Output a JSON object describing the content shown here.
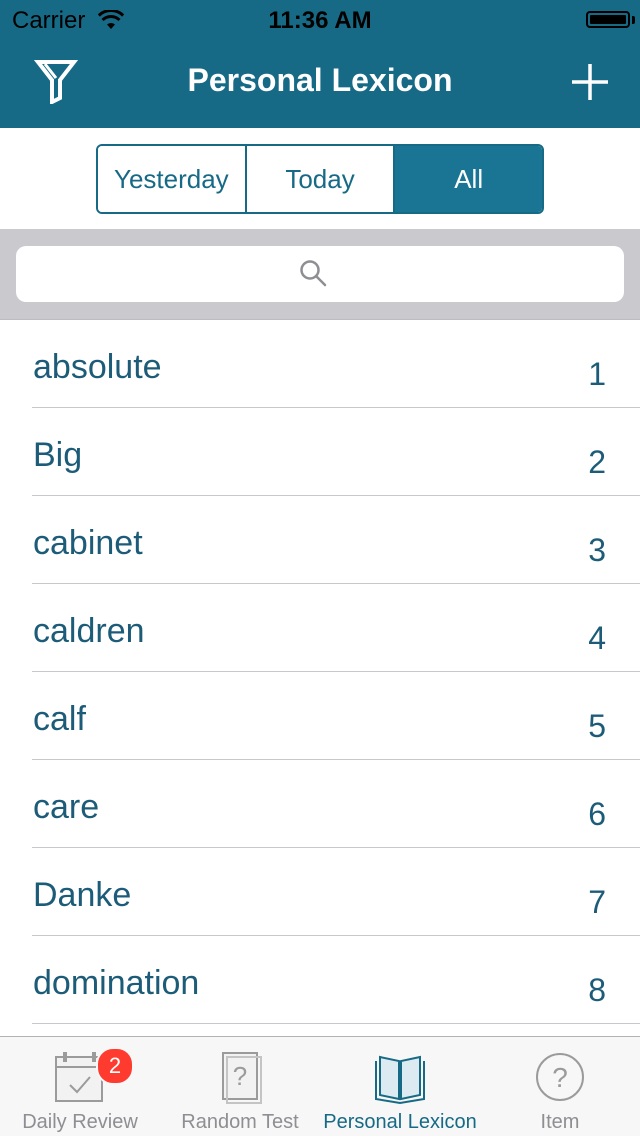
{
  "status_bar": {
    "carrier": "Carrier",
    "time": "11:36 AM"
  },
  "nav": {
    "title": "Personal Lexicon",
    "left_icon": "filter-icon",
    "right_icon": "plus-icon"
  },
  "segments": {
    "items": [
      "Yesterday",
      "Today",
      "All"
    ],
    "selected": "All"
  },
  "search": {
    "placeholder": "",
    "icon": "search-icon"
  },
  "words": [
    {
      "word": "absolute",
      "num": "1"
    },
    {
      "word": "Big",
      "num": "2"
    },
    {
      "word": "cabinet",
      "num": "3"
    },
    {
      "word": "caldren",
      "num": "4"
    },
    {
      "word": "calf",
      "num": "5"
    },
    {
      "word": "care",
      "num": "6"
    },
    {
      "word": "Danke",
      "num": "7"
    },
    {
      "word": "domination",
      "num": "8"
    }
  ],
  "tabs": [
    {
      "label": "Daily Review",
      "icon": "calendar-check-icon",
      "badge": "2"
    },
    {
      "label": "Random Test",
      "icon": "question-card-icon"
    },
    {
      "label": "Personal Lexicon",
      "icon": "open-book-icon",
      "active": true
    },
    {
      "label": "Item",
      "icon": "question-circle-icon"
    }
  ],
  "colors": {
    "accent": "#176a86",
    "badge": "#ff3b30",
    "inactive": "#8e8e93"
  }
}
